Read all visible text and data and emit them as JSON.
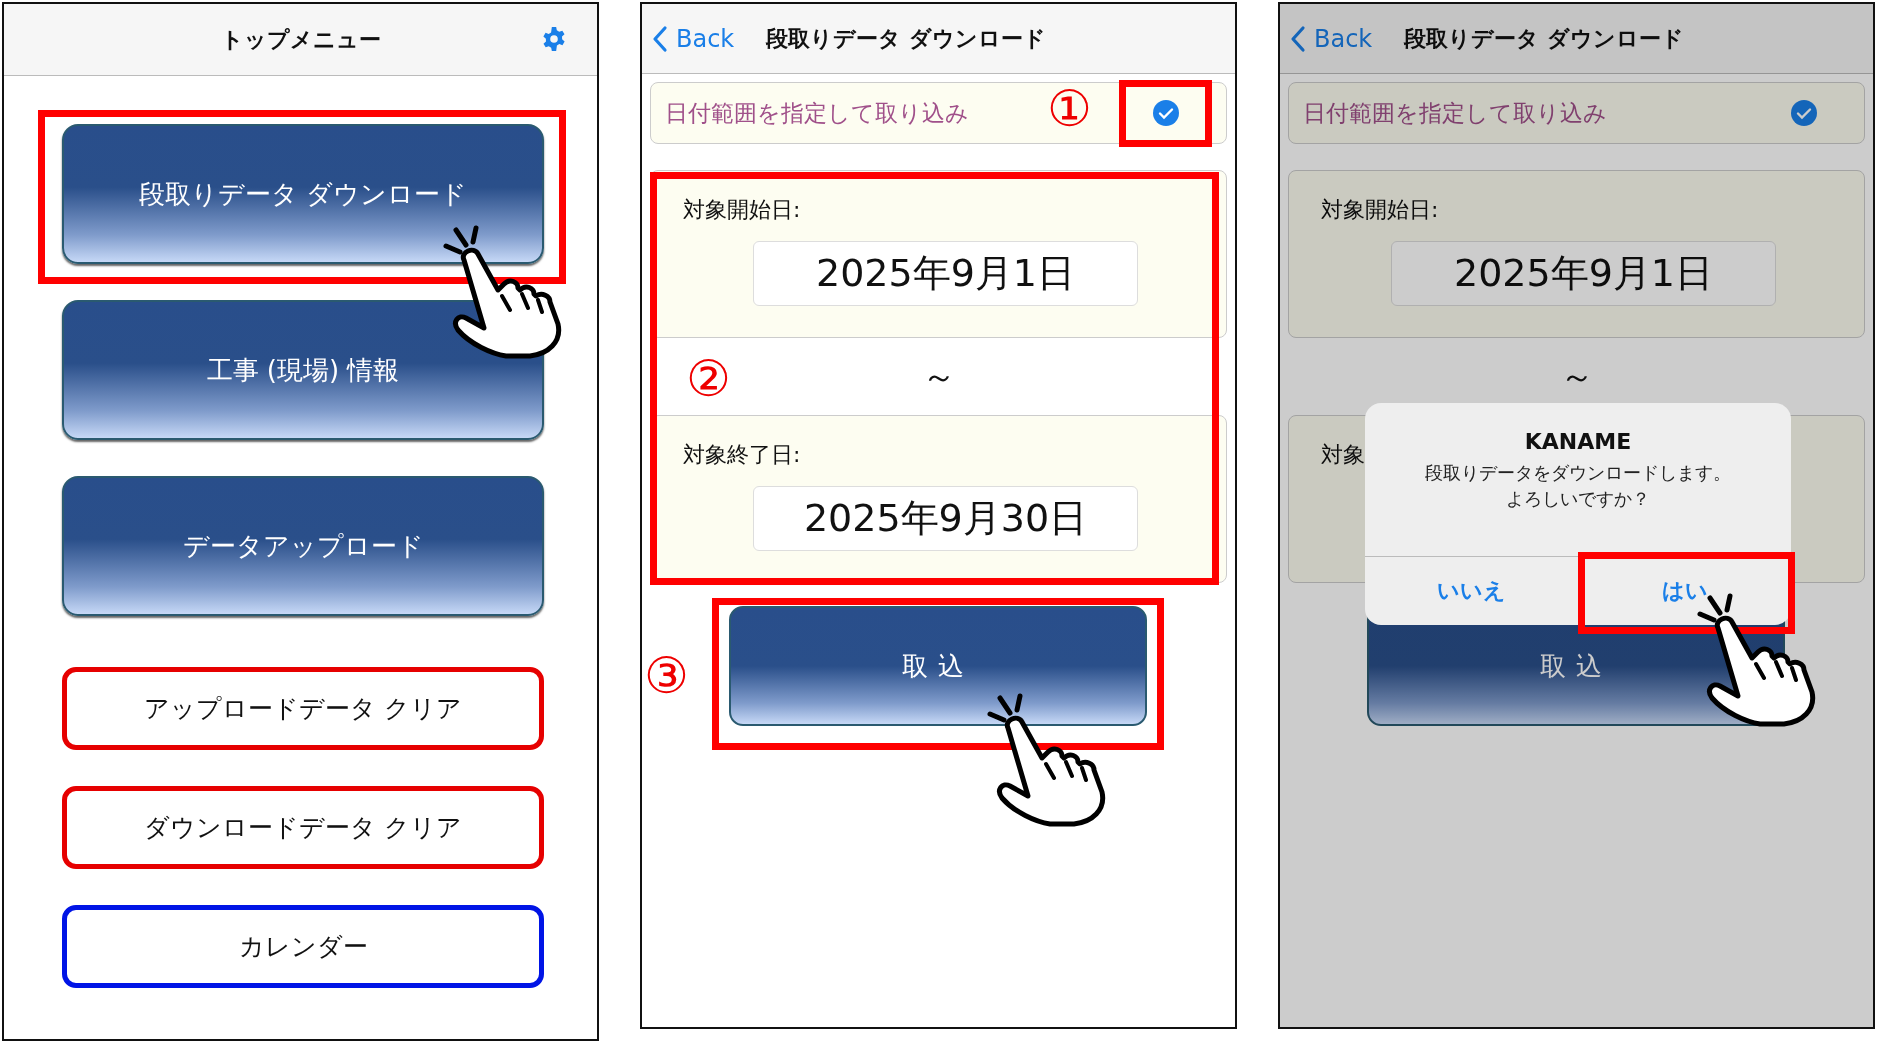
{
  "screens": [
    {
      "kind": "menu",
      "title": "トップメニュー",
      "buttons": [
        {
          "label": "段取りデータ ダウンロード",
          "kind": "primary"
        },
        {
          "label": "工事 (現場) 情報",
          "kind": "primary"
        },
        {
          "label": "データアップロード",
          "kind": "primary"
        },
        {
          "label": "アップロードデータ クリア",
          "kind": "outline",
          "color": "#e60000"
        },
        {
          "label": "ダウンロードデータ クリア",
          "kind": "outline",
          "color": "#e60000"
        },
        {
          "label": "カレンダー",
          "kind": "outline",
          "color": "#0014e6"
        }
      ]
    },
    {
      "kind": "download",
      "back": "Back",
      "title": "段取りデータ ダウンロード",
      "range_option": {
        "label": "日付範囲を指定して取り込み",
        "checked": true
      },
      "start_label": "対象開始日:",
      "start_date": "2025年9月1日",
      "separator": "～",
      "end_label": "対象終了日:",
      "end_date": "2025年9月30日",
      "action": "取込",
      "dimmed": false,
      "markers": [
        "①",
        "②",
        "③"
      ]
    },
    {
      "kind": "download",
      "back": "Back",
      "title": "段取りデータ ダウンロード",
      "range_option": {
        "label": "日付範囲を指定して取り込み",
        "checked": true
      },
      "start_label": "対象開始日:",
      "start_date": "2025年9月1日",
      "separator": "～",
      "end_label": "対象",
      "action": "取込",
      "dimmed": true,
      "dialog": {
        "title": "KANAME",
        "message": [
          "段取りデータをダウンロードします。",
          "よろしいですか？"
        ],
        "buttons": [
          "いいえ",
          "はい"
        ]
      }
    }
  ]
}
